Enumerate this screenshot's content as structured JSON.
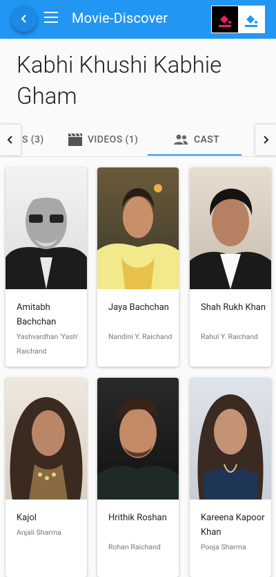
{
  "app": {
    "title": "Movie-Discover"
  },
  "movie": {
    "title": "Kabhi Khushi Kabhie Gham"
  },
  "tabs": [
    {
      "label": "S (3)",
      "icon": "image-icon"
    },
    {
      "label": "VIDEOS (1)",
      "icon": "clapperboard-icon"
    },
    {
      "label": "CAST",
      "icon": "people-icon",
      "active": true
    }
  ],
  "cast": [
    {
      "name": "Amitabh Bachchan",
      "role": "Yashvardhan 'Yash' Raichand"
    },
    {
      "name": "Jaya Bachchan",
      "role": "Nandini Y. Raichand"
    },
    {
      "name": "Shah Rukh Khan",
      "role": "Rahul Y. Raichand"
    },
    {
      "name": "Kajol",
      "role": "Anjali Sharma"
    },
    {
      "name": "Hrithik Roshan",
      "role": "Rohan Raichand"
    },
    {
      "name": "Kareena Kapoor Khan",
      "role": "Pooja Sharma"
    }
  ],
  "colors": {
    "primary": "#2196f3",
    "accent_pink": "#e91e63"
  }
}
